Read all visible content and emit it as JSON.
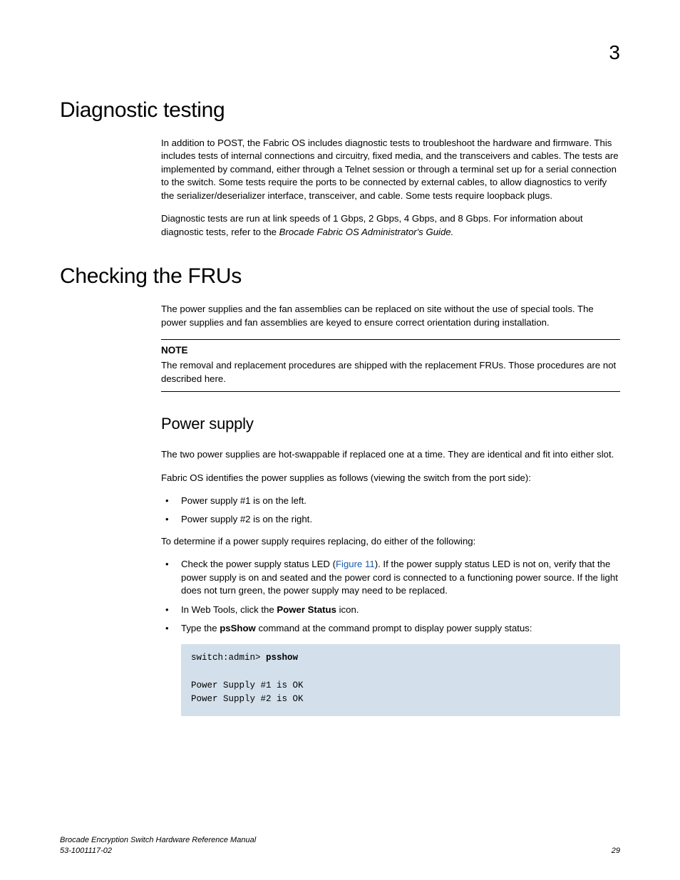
{
  "chapter_number": "3",
  "sections": {
    "diag": {
      "title": "Diagnostic testing",
      "p1": "In addition to POST, the Fabric OS includes diagnostic tests to troubleshoot the hardware and firmware. This includes tests of internal connections and circuitry, fixed media, and the transceivers and cables. The tests are implemented by command, either through a Telnet session or through a terminal set up for a serial connection to the switch. Some tests require the ports to be connected by external cables, to allow diagnostics to verify the serializer/deserializer interface, transceiver, and cable. Some tests require loopback plugs.",
      "p2a": "Diagnostic tests are run at link speeds of 1 Gbps, 2 Gbps, 4 Gbps, and 8 Gbps. For information about diagnostic tests, refer to the ",
      "p2b": "Brocade Fabric OS Administrator's Guide.",
      "p2c": ""
    },
    "frus": {
      "title": "Checking the FRUs",
      "p1": "The power supplies and the fan assemblies can be replaced on site without the use of special tools. The power supplies and fan assemblies are keyed to ensure correct orientation during installation.",
      "note_label": "NOTE",
      "note_body": "The removal and replacement procedures are shipped with the replacement FRUs. Those procedures are not described here."
    },
    "power": {
      "title": "Power supply",
      "p1": "The two power supplies are hot-swappable if replaced one at a time. They are identical and fit into either slot.",
      "p2": "Fabric OS identifies the power supplies as follows (viewing the switch from the port side):",
      "list1": {
        "i0": "Power supply #1 is on the left.",
        "i1": "Power supply #2 is on the right."
      },
      "p3": "To determine if a power supply requires replacing, do either of the following:",
      "list2": {
        "i0a": "Check the power supply status LED (",
        "i0link": "Figure 11",
        "i0b": "). If the power supply status LED is not on, verify that the power supply is on and seated and the power cord is connected to a functioning power source. If the light does not turn green, the power supply may need to be replaced.",
        "i1a": "In Web Tools, click the ",
        "i1bold": "Power Status",
        "i1b": " icon.",
        "i2a": "Type the ",
        "i2bold": "psShow",
        "i2b": " command at the command prompt to display power supply status:"
      },
      "code": {
        "prompt": "switch:admin> ",
        "cmd": "psshow",
        "out1": "Power Supply #1 is OK",
        "out2": "Power Supply #2 is OK"
      }
    }
  },
  "footer": {
    "title": "Brocade Encryption Switch Hardware Reference Manual",
    "docnum": "53-1001117-02",
    "page": "29"
  }
}
